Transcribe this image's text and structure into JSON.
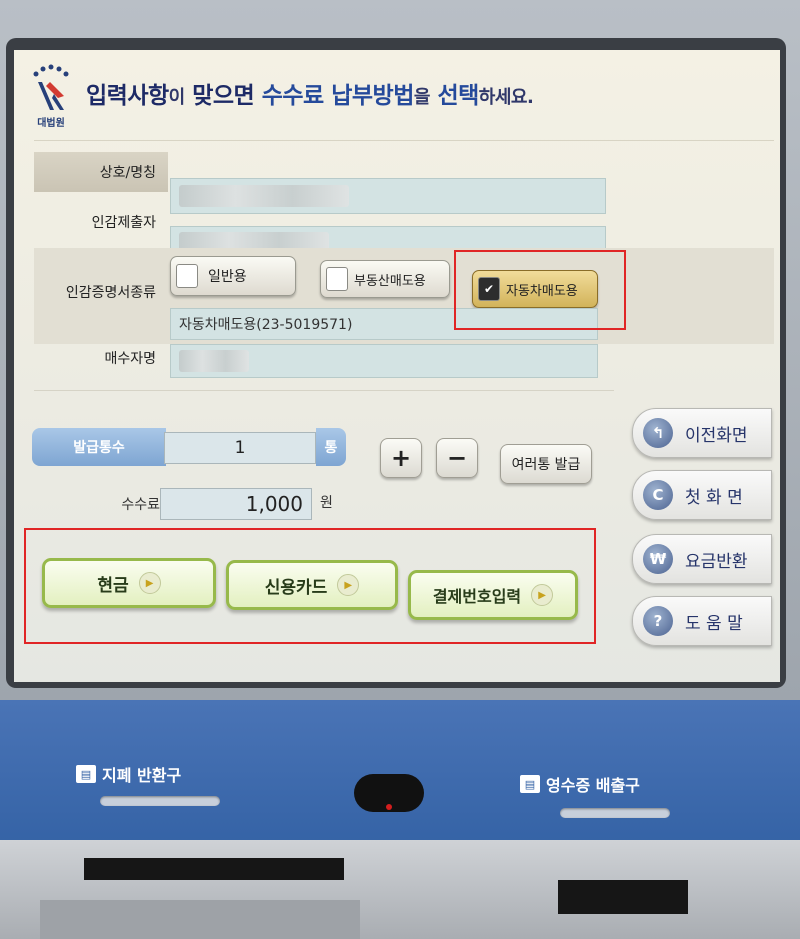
{
  "header": {
    "logo_text": "대법원",
    "title": {
      "p1": "입력사항",
      "p2": "이",
      "p3": "맞으면",
      "p4": "수수료",
      "p5": "납부방법",
      "p6": "을",
      "p7": "선택",
      "p8": "하세요."
    }
  },
  "form": {
    "company_label": "상호/명칭",
    "submitter_label": "인감제출자",
    "cert_type_label": "인감증명서종류",
    "cert_types": [
      {
        "label": "일반용",
        "selected": false
      },
      {
        "label": "부동산매도용",
        "selected": false
      },
      {
        "label": "자동차매도용",
        "selected": true
      }
    ],
    "cert_type_value": "자동차매도용(23-5019571)",
    "buyer_label": "매수자명"
  },
  "issue": {
    "count_label": "발급통수",
    "count_value": "1",
    "count_unit": "통",
    "plus": "+",
    "minus": "−",
    "multi_label": "여러통 발급",
    "fee_label": "수수료",
    "fee_value": "1,000",
    "fee_unit": "원"
  },
  "payment": {
    "buttons": [
      {
        "label": "현금"
      },
      {
        "label": "신용카드"
      },
      {
        "label": "결제번호입력"
      }
    ]
  },
  "nav": {
    "buttons": [
      {
        "label": "이전화면",
        "icon": "back-arrow-icon",
        "glyph": "↰"
      },
      {
        "label": "첫 화 면",
        "icon": "home-c-icon",
        "glyph": "C"
      },
      {
        "label": "요금반환",
        "icon": "won-icon",
        "glyph": "₩"
      },
      {
        "label": "도 움 말",
        "icon": "help-icon",
        "glyph": "?"
      }
    ]
  },
  "kiosk": {
    "bill_return_label": "지폐 반환구",
    "receipt_label": "영수증 배출구"
  },
  "colors": {
    "highlight_box": "#e02525",
    "title_text": "#1d2a66",
    "payment_border": "#97b94b"
  }
}
